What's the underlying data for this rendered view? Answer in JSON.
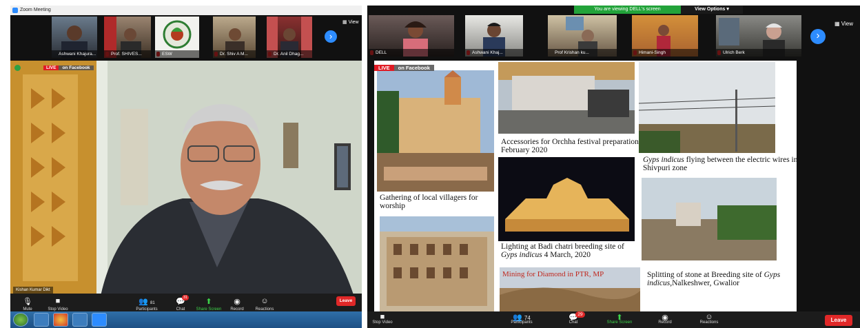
{
  "left_window": {
    "title": "Zoom Meeting",
    "participants": [
      {
        "name": "Ashwani Khajura..."
      },
      {
        "name": "Prof. SHIVES..."
      },
      {
        "name": "ESW"
      },
      {
        "name": "Dr. Shiv A M..."
      },
      {
        "name": "Dr. Anil Dhag..."
      }
    ],
    "view_label": "View",
    "live_label": "LIVE",
    "on_facebook": "on Facebook",
    "speaker_name": "Kishan Kumar Dikt",
    "toolbar": {
      "mute": "Mute",
      "stop_video": "Stop Video",
      "participants": "Participants",
      "participants_count": "81",
      "chat": "Chat",
      "chat_badge": "31",
      "share_screen": "Share Screen",
      "record": "Record",
      "reactions": "Reactions",
      "leave": "Leave"
    }
  },
  "right_window": {
    "banner": "You are viewing DELL's screen",
    "view_options": "View Options",
    "participants": [
      {
        "name": "DELL"
      },
      {
        "name": "Ashwani Khaj..."
      },
      {
        "name": "Prof Krishan ku..."
      },
      {
        "name": "Himani-Singh"
      },
      {
        "name": "Ulrich Berk"
      }
    ],
    "view_label": "View",
    "live_label": "LIVE",
    "on_facebook": "on Facebook",
    "slide": {
      "captions": {
        "gathering": "Gathering of local villagers for worship",
        "accessories": "Accessories for Orchha festival preparation February 2020",
        "lighting_a": "Lighting at Badi chatri breeding site of ",
        "lighting_b": "Gyps indicus",
        "lighting_c": " 4 March, 2020",
        "gyps_a": "Gyps indicus",
        "gyps_b": " flying between the electric wires in Shivpuri zone",
        "mining": "Mining for Diamond in PTR, MP",
        "splitting_a": "Splitting of stone at Breeding site of ",
        "splitting_b": "Gyps indicus",
        "splitting_c": ",Nalkeshwer, Gwalior"
      }
    },
    "toolbar": {
      "stop_video": "Stop Video",
      "participants": "Participants",
      "participants_count": "74",
      "chat": "Chat",
      "chat_badge": "29",
      "share_screen": "Share Screen",
      "record": "Record",
      "reactions": "Reactions",
      "leave": "Leave"
    }
  }
}
